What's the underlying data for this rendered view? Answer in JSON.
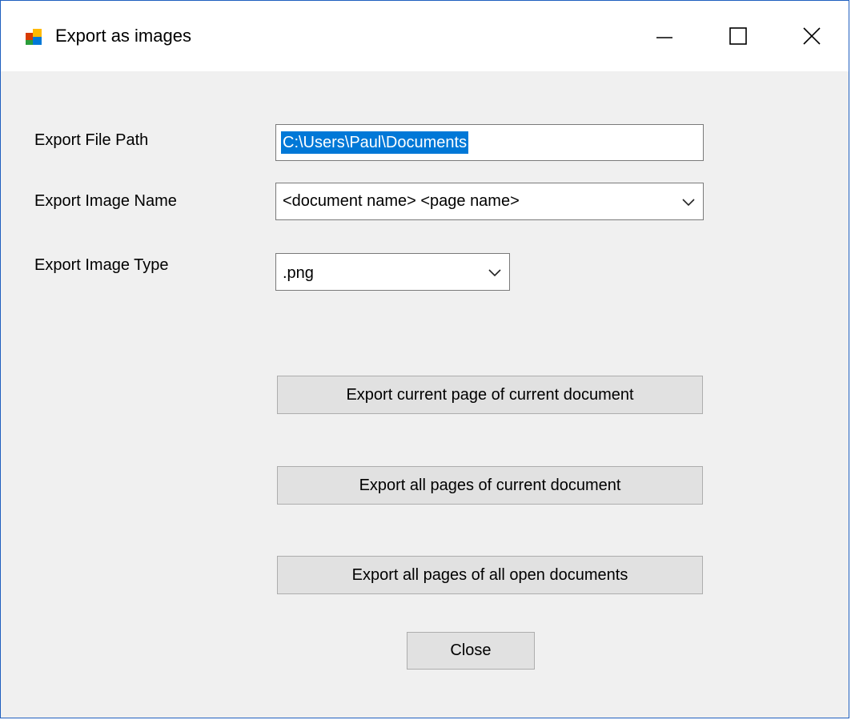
{
  "window": {
    "title": "Export as images",
    "icon": "app-window-icon",
    "controls": {
      "minimize_icon": "minimize-icon",
      "maximize_icon": "maximize-icon",
      "close_icon": "close-icon"
    }
  },
  "form": {
    "file_path": {
      "label": "Export File Path",
      "value": "C:\\Users\\Paul\\Documents"
    },
    "image_name": {
      "label": "Export Image Name",
      "selected": "<document name> <page name>"
    },
    "image_type": {
      "label": "Export Image Type",
      "selected": ".png"
    }
  },
  "buttons": {
    "export_current_page": "Export current page of current document",
    "export_all_pages": "Export all pages of current document",
    "export_all_documents": "Export all pages of all open documents",
    "close": "Close"
  },
  "colors": {
    "selection": "#0078d7",
    "window_border": "#1f5fbf",
    "dialog_background": "#f0f0f0",
    "button_face": "#e1e1e1"
  }
}
